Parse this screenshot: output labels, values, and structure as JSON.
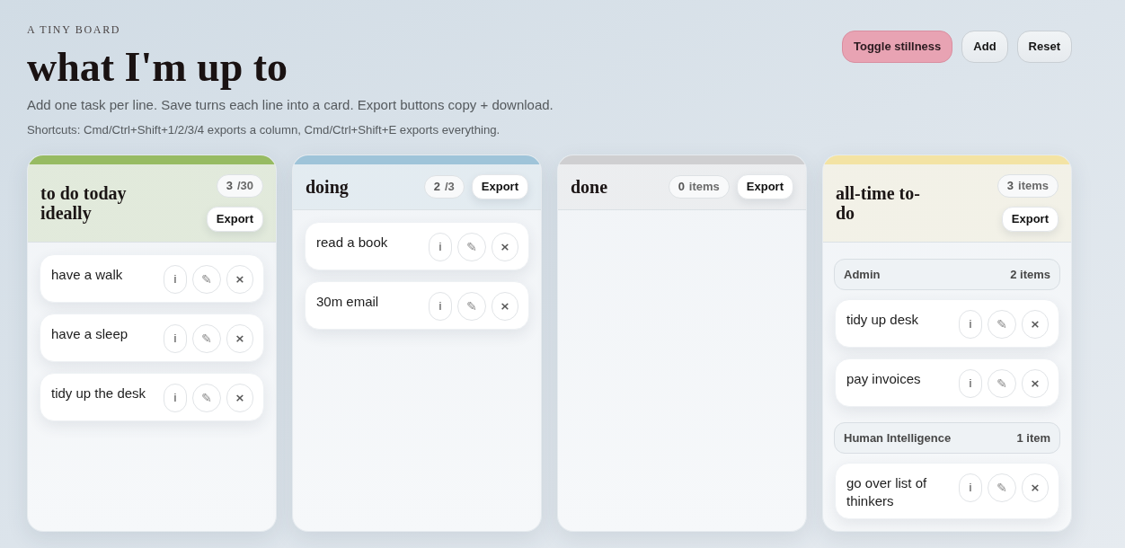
{
  "header": {
    "eyebrow": "A TINY BOARD",
    "title": "what I'm up to",
    "description": "Add one task per line. Save turns each line into a card. Export buttons copy + download.",
    "shortcuts": "Shortcuts: Cmd/Ctrl+Shift+1/2/3/4 exports a column, Cmd/Ctrl+Shift+E exports everything."
  },
  "toolbar": [
    {
      "label": "Toggle stillness",
      "kind": "accent"
    },
    {
      "label": "Add",
      "kind": "plain"
    },
    {
      "label": "Reset",
      "kind": "plain"
    }
  ],
  "columns": [
    {
      "title": "to do today ideally",
      "color": "#97bb63",
      "count": "3",
      "count_suffix": "/30",
      "export": "Export",
      "kind": "list",
      "cards": [
        {
          "text": "have a walk",
          "buttons": [
            "i",
            "✎",
            "×"
          ]
        },
        {
          "text": "have a sleep",
          "buttons": [
            "i",
            "✎",
            "×"
          ]
        },
        {
          "text": "tidy up the desk",
          "buttons": [
            "i",
            "✎",
            "×"
          ]
        }
      ]
    },
    {
      "title": "doing",
      "color": "#9fc4d9",
      "count": "2",
      "count_suffix": "/3",
      "export": "Export",
      "kind": "list",
      "cards": [
        {
          "text": "read a book",
          "buttons": [
            "i",
            "✎",
            "×"
          ]
        },
        {
          "text": "30m email",
          "buttons": [
            "i",
            "✎",
            "×"
          ]
        }
      ]
    },
    {
      "title": "done",
      "color": "#cfcfd1",
      "count": "0",
      "count_suffix": "items",
      "export": "Export",
      "kind": "list"
    },
    {
      "title": "all-time to-do",
      "color": "#f3e3a4",
      "count": "3",
      "count_suffix": "items",
      "export": "Export",
      "kind": "grouped",
      "groups": [
        {
          "name": "Admin",
          "count": "2 items",
          "cards": [
            {
              "text": "tidy up desk",
              "buttons": [
                "i",
                "✎",
                "×"
              ]
            },
            {
              "text": "pay invoices",
              "buttons": [
                "i",
                "✎",
                "×"
              ]
            }
          ]
        },
        {
          "name": "Human Intelligence",
          "count": "1 item",
          "cards": [
            {
              "text": "go over list of thinkers",
              "buttons": [
                "i",
                "✎",
                "×"
              ]
            }
          ]
        }
      ]
    }
  ]
}
